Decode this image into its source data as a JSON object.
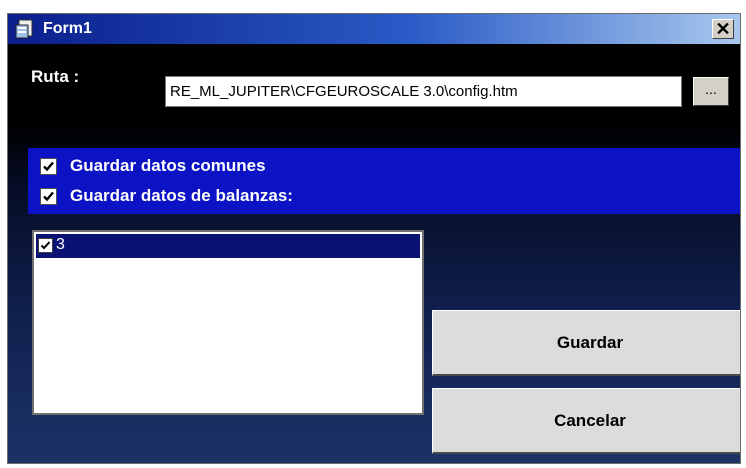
{
  "window": {
    "title": "Form1",
    "close_glyph": "✕"
  },
  "ruta": {
    "label": "Ruta :",
    "path_value": "RE_ML_JUPITER\\CFGEUROSCALE 3.0\\config.htm",
    "browse_label": "..."
  },
  "options": [
    {
      "label": "Guardar datos comunes",
      "checked": true
    },
    {
      "label": "Guardar datos de balanzas:",
      "checked": true
    }
  ],
  "scales_list": [
    {
      "label": "3",
      "checked": true,
      "selected": true
    }
  ],
  "buttons": {
    "save_label": "Guardar",
    "cancel_label": "Cancelar"
  },
  "icons": [
    "app-icon",
    "close-icon",
    "checkmark-icon"
  ],
  "colors": {
    "titlebar_start": "#0a1e8c",
    "titlebar_end": "#a8c8ee",
    "options_panel": "#0c13c4",
    "list_selected": "#0a1274"
  }
}
